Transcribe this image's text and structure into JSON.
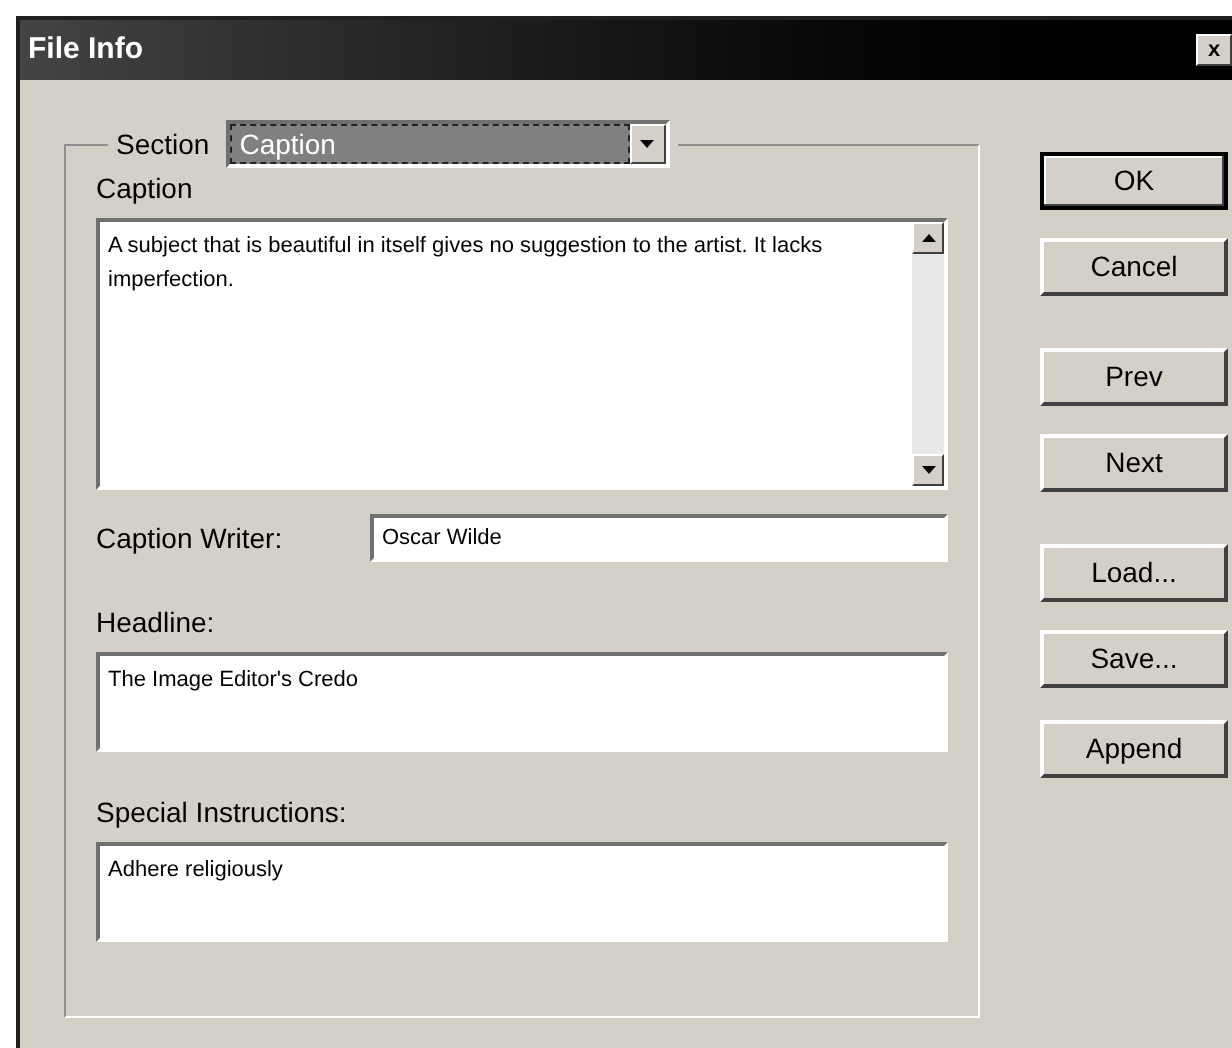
{
  "window": {
    "title": "File Info",
    "close": "x"
  },
  "section": {
    "label": "Section",
    "value": "Caption"
  },
  "fields": [
    {
      "kind": "multiline",
      "label": "Caption",
      "value": "A subject that is beautiful in itself gives no suggestion to the artist. It lacks imperfection.",
      "scrollbar": true
    },
    {
      "kind": "inline",
      "label": "Caption Writer:",
      "value": "Oscar Wilde"
    },
    {
      "kind": "multiline",
      "label": "Headline:",
      "value": "The Image Editor's Credo",
      "scrollbar": false
    },
    {
      "kind": "multiline",
      "label": "Special Instructions:",
      "value": "Adhere religiously",
      "scrollbar": false
    }
  ],
  "buttons": [
    {
      "label": "OK",
      "default": true
    },
    {
      "label": "Cancel",
      "default": false
    },
    {
      "label": "Prev",
      "default": false
    },
    {
      "label": "Next",
      "default": false
    },
    {
      "label": "Load...",
      "default": false
    },
    {
      "label": "Save...",
      "default": false
    },
    {
      "label": "Append",
      "default": false
    }
  ]
}
